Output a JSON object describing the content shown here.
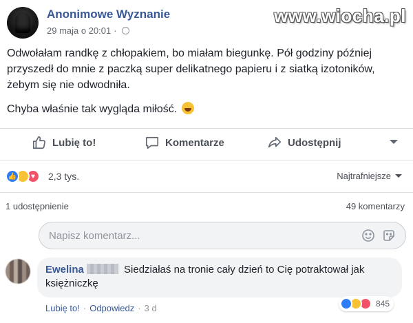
{
  "post": {
    "page_name": "Anonimowe Wyznanie",
    "date": "29 maja o 20:01",
    "meta_separator": "·",
    "audience_icon": "globe-icon",
    "paragraph1": "Odwołałam randkę z chłopakiem, bo miałam biegunkę. Pół godziny później przyszedł do mnie z paczką super delikatnego papieru i z siatką izotoników, żebym się nie odwodniła.",
    "paragraph2": "Chyba właśnie tak wygląda miłość.",
    "paragraph2_emoji": "grinning-face-icon"
  },
  "watermark": "www.wiocha.pl",
  "actions": {
    "like_label": "Lubię to!",
    "comment_label": "Komentarze",
    "share_label": "Udostępnij"
  },
  "reactions": {
    "types": [
      "like",
      "haha",
      "love"
    ],
    "count": "2,3 tys.",
    "sort_label": "Najtrafniejsze"
  },
  "stats": {
    "shares": "1 udostępnienie",
    "comments": "49 komentarzy"
  },
  "comment_input": {
    "placeholder": "Napisz komentarz..."
  },
  "comment": {
    "author": "Ewelina",
    "text": "Siedziałaś na tronie cały dzień to Cię potraktował jak księżniczkę",
    "reaction_types": [
      "like",
      "haha",
      "love"
    ],
    "reaction_count": "845",
    "like_label": "Lubię to!",
    "reply_label": "Odpowiedz",
    "time": "3 d",
    "separator": "·"
  },
  "colors": {
    "link_blue": "#385898",
    "like_blue": "#2e7cf6",
    "haha_yellow": "#f7c234",
    "love_red": "#f25268"
  }
}
